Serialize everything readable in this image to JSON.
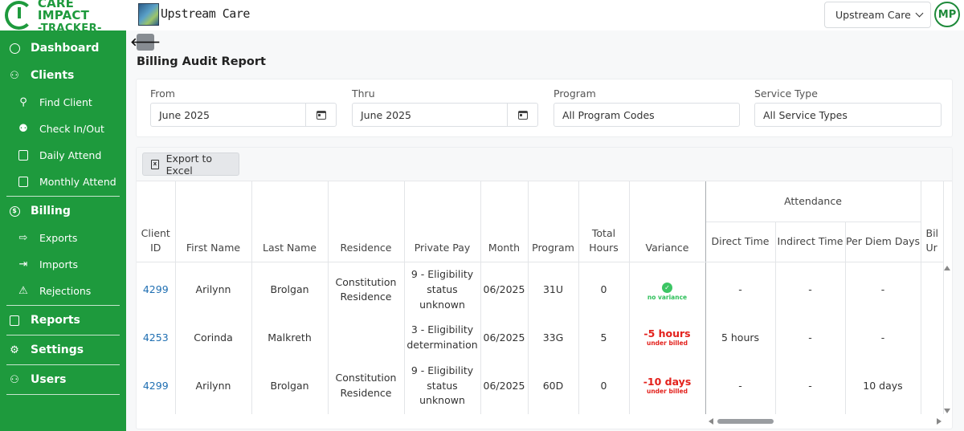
{
  "brand": {
    "title": "CARE IMPACT",
    "subtitle": "-TRACKER-"
  },
  "topbar": {
    "org_name": "Upstream Care",
    "org_select_value": "Upstream Care",
    "avatar_initials": "MP"
  },
  "sidebar": {
    "sections": [
      {
        "label": "Dashboard",
        "icon": "dashboard-icon"
      },
      {
        "label": "Clients",
        "icon": "clients-icon",
        "items": [
          {
            "label": "Find Client",
            "icon": "search-icon"
          },
          {
            "label": "Check In/Out",
            "icon": "user-check-icon"
          },
          {
            "label": "Daily Attend",
            "icon": "calendar-day-icon"
          },
          {
            "label": "Monthly Attend",
            "icon": "calendar-month-icon"
          }
        ]
      },
      {
        "label": "Billing",
        "icon": "dollar-icon",
        "items": [
          {
            "label": "Exports",
            "icon": "export-icon"
          },
          {
            "label": "Imports",
            "icon": "import-icon"
          },
          {
            "label": "Rejections",
            "icon": "warning-icon"
          }
        ]
      },
      {
        "label": "Reports",
        "icon": "report-icon"
      },
      {
        "label": "Settings",
        "icon": "gear-icon"
      },
      {
        "label": "Users",
        "icon": "users-icon"
      }
    ]
  },
  "page": {
    "title": "Billing Audit Report"
  },
  "filters": {
    "from": {
      "label": "From",
      "value": "June 2025"
    },
    "thru": {
      "label": "Thru",
      "value": "June 2025"
    },
    "program": {
      "label": "Program",
      "value": "All Program Codes"
    },
    "service_type": {
      "label": "Service Type",
      "value": "All Service Types"
    }
  },
  "toolbar": {
    "export_label": "Export to Excel"
  },
  "table": {
    "headers": {
      "client_id": "Client ID",
      "first_name": "First Name",
      "last_name": "Last Name",
      "residence": "Residence",
      "private_pay": "Private Pay",
      "month": "Month",
      "program": "Program",
      "total_hours": "Total Hours",
      "variance": "Variance",
      "attendance_group": "Attendance",
      "direct_time": "Direct Time",
      "indirect_time": "Indirect Time",
      "per_diem_days": "Per Diem Days",
      "billed_units_partial": "Bil Ur"
    },
    "rows": [
      {
        "client_id": "4299",
        "first_name": "Arilynn",
        "last_name": "Brolgan",
        "residence": "Constitution Residence",
        "private_pay": "9 - Eligibility status unknown",
        "month": "06/2025",
        "program": "31U",
        "total_hours": "0",
        "variance_main": "",
        "variance_sub": "no variance",
        "variance_status": "ok",
        "direct_time": "-",
        "indirect_time": "-",
        "per_diem_days": "-"
      },
      {
        "client_id": "4253",
        "first_name": "Corinda",
        "last_name": "Malkreth",
        "residence": "",
        "private_pay": "3 - Eligibility determination",
        "month": "06/2025",
        "program": "33G",
        "total_hours": "5",
        "variance_main": "-5 hours",
        "variance_sub": "under billed",
        "variance_status": "bad",
        "direct_time": "5 hours",
        "indirect_time": "-",
        "per_diem_days": "-"
      },
      {
        "client_id": "4299",
        "first_name": "Arilynn",
        "last_name": "Brolgan",
        "residence": "Constitution Residence",
        "private_pay": "9 - Eligibility status unknown",
        "month": "06/2025",
        "program": "60D",
        "total_hours": "0",
        "variance_main": "-10 days",
        "variance_sub": "under billed",
        "variance_status": "bad",
        "direct_time": "-",
        "indirect_time": "-",
        "per_diem_days": "10 days"
      }
    ]
  },
  "colors": {
    "sidebar_green": "#1e9a3d",
    "link_blue": "#1f6fb2",
    "variance_red": "#e3211c",
    "variance_green": "#2ec05a"
  }
}
